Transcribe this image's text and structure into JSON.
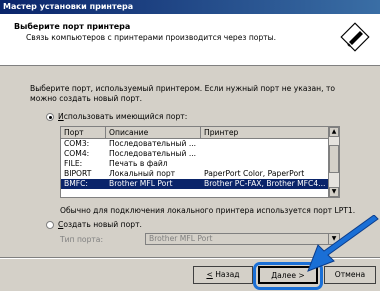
{
  "window": {
    "title": "Мастер установки принтера"
  },
  "header": {
    "title": "Выберите порт принтера",
    "subtitle": "Связь компьютеров с принтерами производится через порты."
  },
  "description": "Выберите порт, используемый принтером. Если нужный порт не указан, то можно создать новый порт.",
  "use_existing": {
    "u": "И",
    "rest": "спользовать имеющийся порт:",
    "selected": true
  },
  "port_table": {
    "columns": [
      "Порт",
      "Описание",
      "Принтер"
    ],
    "rows": [
      {
        "port": "COM3:",
        "desc": "Последовательный ...",
        "printer": ""
      },
      {
        "port": "COM4:",
        "desc": "Последовательный ...",
        "printer": ""
      },
      {
        "port": "FILE:",
        "desc": "Печать в файл",
        "printer": ""
      },
      {
        "port": "BIPORT",
        "desc": "Локальный порт",
        "printer": "PaperPort Color, PaperPort"
      },
      {
        "port": "BMFC:",
        "desc": "Brother MFL Port",
        "printer": "Brother PC-FAX, Brother MFC4...",
        "selected": true
      }
    ]
  },
  "note": "Обычно для подключения локального принтера используется порт LPT1.",
  "create_new": {
    "u": "С",
    "rest": "оздать новый порт.",
    "selected": false,
    "type_label": "Тип порта:",
    "type_value": "Brother MFL Port"
  },
  "buttons": {
    "back_u": "<",
    "back_rest": " Назад",
    "next": "Далее >",
    "cancel": "Отмена"
  },
  "colors": {
    "highlight_frame": "#1a6fd6",
    "arrow": "#1a6fd6",
    "selection": "#0a246a"
  }
}
